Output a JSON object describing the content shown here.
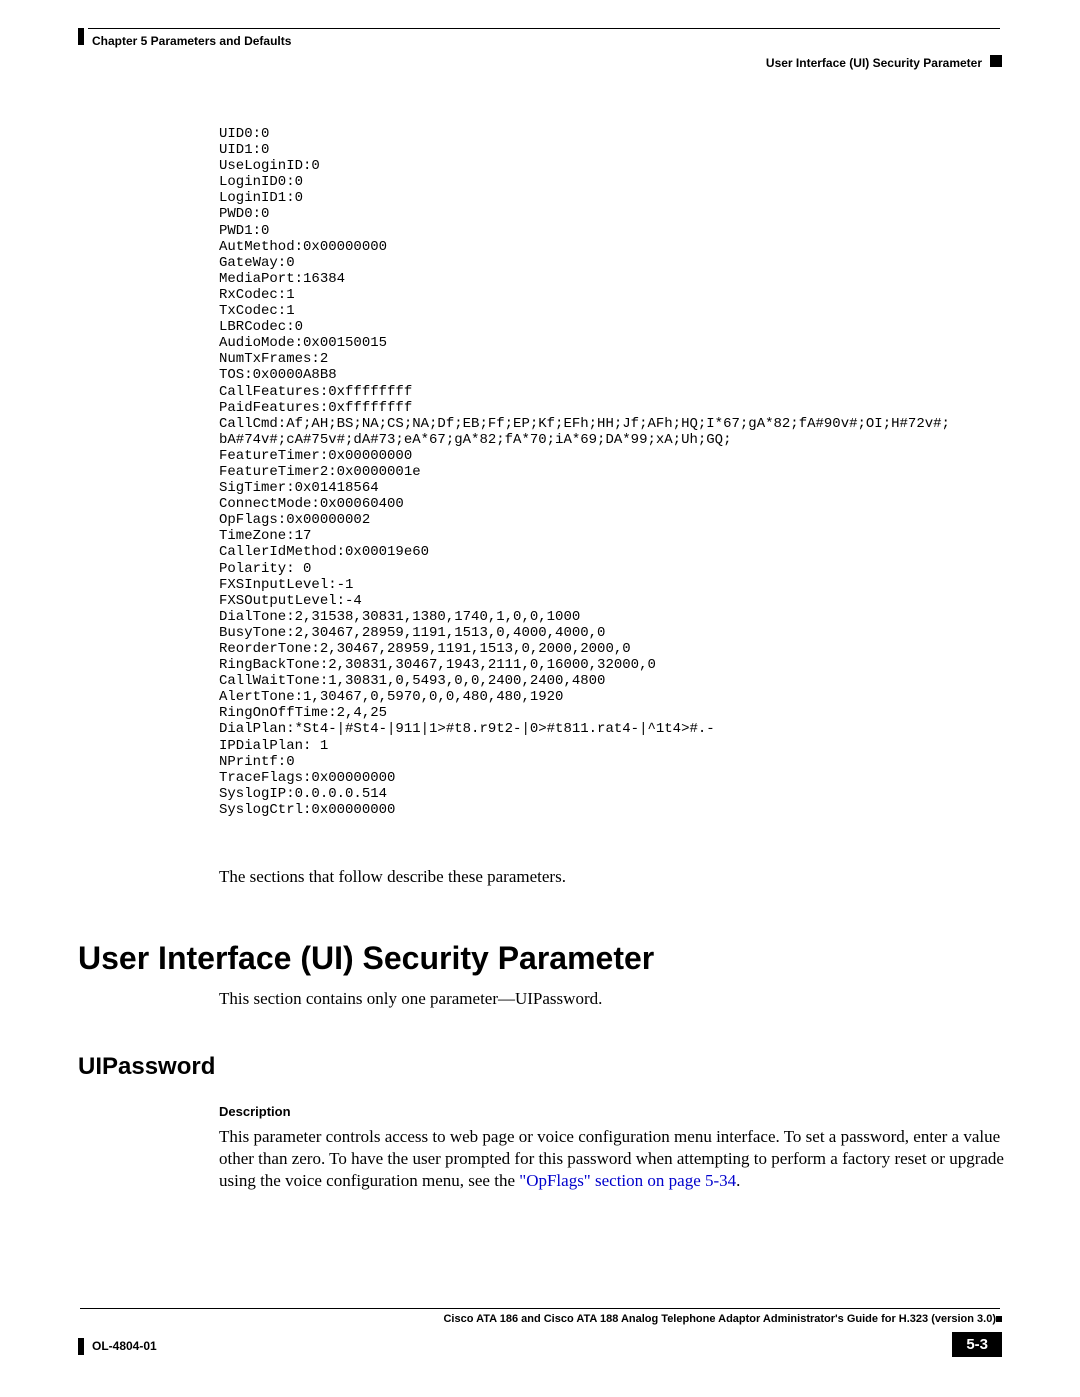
{
  "header": {
    "chapter": "Chapter 5    Parameters and Defaults",
    "breadcrumb": "User Interface (UI) Security Parameter"
  },
  "code": "UID0:0\nUID1:0\nUseLoginID:0\nLoginID0:0\nLoginID1:0\nPWD0:0\nPWD1:0\nAutMethod:0x00000000\nGateWay:0\nMediaPort:16384\nRxCodec:1\nTxCodec:1\nLBRCodec:0\nAudioMode:0x00150015\nNumTxFrames:2\nTOS:0x0000A8B8\nCallFeatures:0xffffffff\nPaidFeatures:0xffffffff\nCallCmd:Af;AH;BS;NA;CS;NA;Df;EB;Ff;EP;Kf;EFh;HH;Jf;AFh;HQ;I*67;gA*82;fA#90v#;OI;H#72v#;\nbA#74v#;cA#75v#;dA#73;eA*67;gA*82;fA*70;iA*69;DA*99;xA;Uh;GQ;\nFeatureTimer:0x00000000\nFeatureTimer2:0x0000001e\nSigTimer:0x01418564\nConnectMode:0x00060400\nOpFlags:0x00000002\nTimeZone:17\nCallerIdMethod:0x00019e60\nPolarity: 0\nFXSInputLevel:-1\nFXSOutputLevel:-4\nDialTone:2,31538,30831,1380,1740,1,0,0,1000\nBusyTone:2,30467,28959,1191,1513,0,4000,4000,0\nReorderTone:2,30467,28959,1191,1513,0,2000,2000,0\nRingBackTone:2,30831,30467,1943,2111,0,16000,32000,0\nCallWaitTone:1,30831,0,5493,0,0,2400,2400,4800\nAlertTone:1,30467,0,5970,0,0,480,480,1920\nRingOnOffTime:2,4,25\nDialPlan:*St4-|#St4-|911|1>#t8.r9t2-|0>#t811.rat4-|^1t4>#.-\nIPDialPlan: 1\nNPrintf:0\nTraceFlags:0x00000000\nSyslogIP:0.0.0.0.514\nSyslogCtrl:0x00000000",
  "followup": "The sections that follow describe these parameters.",
  "h1": "User Interface (UI) Security Parameter",
  "h1sub": "This section contains only one parameter—UIPassword.",
  "h2": "UIPassword",
  "h3": "Description",
  "para_pre": "This parameter controls access to web page or voice configuration menu interface. To set a password, enter a value other than zero. To have the user prompted for this password when attempting to perform a factory reset or upgrade using the voice configuration menu, see the ",
  "para_link": "\"OpFlags\" section on page 5-34",
  "para_post": ".",
  "footer": {
    "title": "Cisco ATA 186 and Cisco ATA 188 Analog Telephone Adaptor Administrator's Guide for H.323 (version 3.0)",
    "docid": "OL-4804-01",
    "page": "5-3"
  }
}
